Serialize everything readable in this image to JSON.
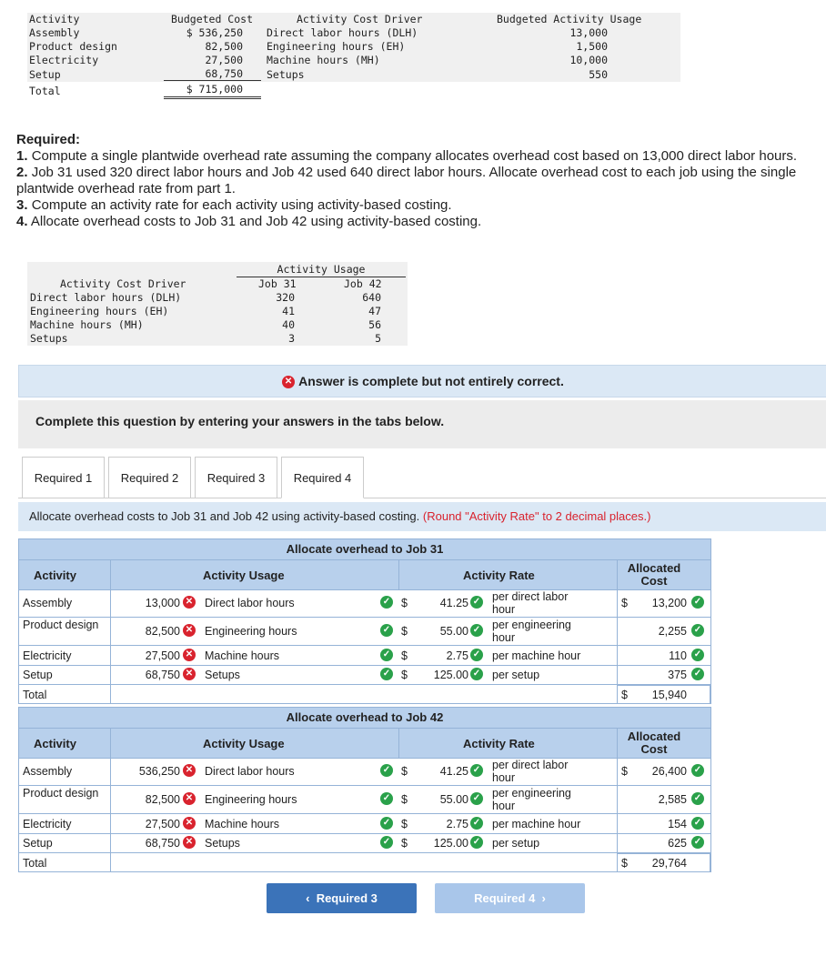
{
  "top_table": {
    "headers": [
      "Activity",
      "Budgeted Cost",
      "Activity Cost Driver",
      "Budgeted Activity Usage"
    ],
    "rows": [
      {
        "activity": "Assembly",
        "cost": "$ 536,250",
        "driver": "Direct labor hours (DLH)",
        "usage": "13,000"
      },
      {
        "activity": "Product design",
        "cost": "82,500",
        "driver": "Engineering hours (EH)",
        "usage": "1,500"
      },
      {
        "activity": "Electricity",
        "cost": "27,500",
        "driver": "Machine hours (MH)",
        "usage": "10,000"
      },
      {
        "activity": "Setup",
        "cost": "68,750",
        "driver": "Setups",
        "usage": "550"
      }
    ],
    "total_label": "Total",
    "total_cost": "$ 715,000"
  },
  "required": {
    "heading": "Required:",
    "items": [
      {
        "num": "1.",
        "text": "Compute a single plantwide overhead rate assuming the company allocates overhead cost based on 13,000 direct labor hours."
      },
      {
        "num": "2.",
        "text": "Job 31 used 320 direct labor hours and Job 42 used 640 direct labor hours. Allocate overhead cost to each job using the single plantwide overhead rate from part 1."
      },
      {
        "num": "3.",
        "text": "Compute an activity rate for each activity using activity-based costing."
      },
      {
        "num": "4.",
        "text": "Allocate overhead costs to Job 31 and Job 42 using activity-based costing."
      }
    ]
  },
  "usage_table": {
    "group_header": "Activity Usage",
    "driver_header": "Activity Cost Driver",
    "job31_header": "Job 31",
    "job42_header": "Job 42",
    "rows": [
      {
        "driver": "Direct labor hours (DLH)",
        "job31": "320",
        "job42": "640"
      },
      {
        "driver": "Engineering hours (EH)",
        "job31": "41",
        "job42": "47"
      },
      {
        "driver": "Machine hours (MH)",
        "job31": "40",
        "job42": "56"
      },
      {
        "driver": "Setups",
        "job31": "3",
        "job42": "5"
      }
    ]
  },
  "banner": {
    "text": "Answer is complete but not entirely correct."
  },
  "complete_text": "Complete this question by entering your answers in the tabs below.",
  "tabs": [
    "Required 1",
    "Required 2",
    "Required 3",
    "Required 4"
  ],
  "instruction": {
    "main": "Allocate overhead costs to Job 31 and Job 42 using activity-based costing.",
    "note": "(Round \"Activity Rate\" to 2 decimal places.)"
  },
  "headers": {
    "activity": "Activity",
    "usage": "Activity Usage",
    "rate": "Activity Rate",
    "allocated": "Allocated Cost",
    "dollar": "$",
    "total": "Total"
  },
  "job31": {
    "title": "Allocate overhead to Job 31",
    "rows": [
      {
        "activity": "Assembly",
        "usage_value": "13,000",
        "usage_driver": "Direct labor hours",
        "rate": "41.25",
        "rate_unit": "per direct labor hour",
        "allocated": "13,200"
      },
      {
        "activity": "Product design",
        "usage_value": "82,500",
        "usage_driver": "Engineering hours",
        "rate": "55.00",
        "rate_unit": "per engineering hour",
        "allocated": "2,255"
      },
      {
        "activity": "Electricity",
        "usage_value": "27,500",
        "usage_driver": "Machine hours",
        "rate": "2.75",
        "rate_unit": "per machine hour",
        "allocated": "110"
      },
      {
        "activity": "Setup",
        "usage_value": "68,750",
        "usage_driver": "Setups",
        "rate": "125.00",
        "rate_unit": "per setup",
        "allocated": "375"
      }
    ],
    "total": "15,940"
  },
  "job42": {
    "title": "Allocate overhead to Job 42",
    "rows": [
      {
        "activity": "Assembly",
        "usage_value": "536,250",
        "usage_driver": "Direct labor hours",
        "rate": "41.25",
        "rate_unit": "per direct labor hour",
        "allocated": "26,400"
      },
      {
        "activity": "Product design",
        "usage_value": "82,500",
        "usage_driver": "Engineering hours",
        "rate": "55.00",
        "rate_unit": "per engineering hour",
        "allocated": "2,585"
      },
      {
        "activity": "Electricity",
        "usage_value": "27,500",
        "usage_driver": "Machine hours",
        "rate": "2.75",
        "rate_unit": "per machine hour",
        "allocated": "154"
      },
      {
        "activity": "Setup",
        "usage_value": "68,750",
        "usage_driver": "Setups",
        "rate": "125.00",
        "rate_unit": "per setup",
        "allocated": "625"
      }
    ],
    "total": "29,764"
  },
  "nav": {
    "prev": "Required 3",
    "next": "Required 4"
  },
  "colors": {
    "correct": "#2aa14a",
    "incorrect": "#d9232e",
    "nav_prev": "#3b73b9",
    "nav_next": "#a9c6ea"
  }
}
